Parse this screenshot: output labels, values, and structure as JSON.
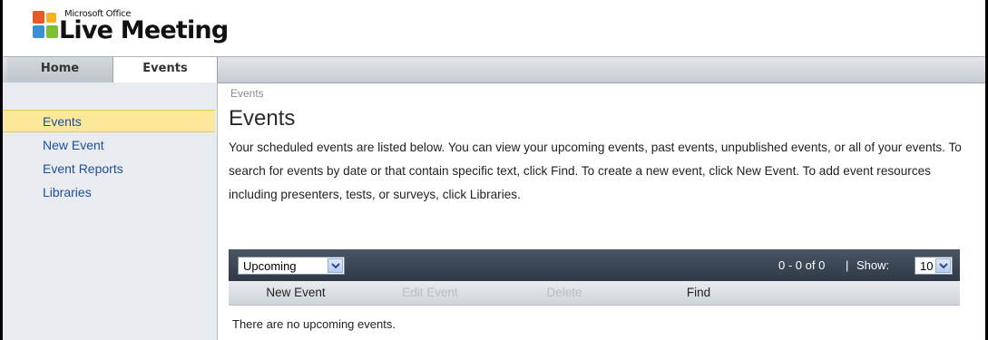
{
  "app": {
    "brand_small": "Microsoft Office",
    "brand_big": "Live Meeting"
  },
  "nav": {
    "tabs": [
      {
        "label": "Home",
        "active": false
      },
      {
        "label": "Events",
        "active": true
      }
    ]
  },
  "sidebar": {
    "items": [
      {
        "label": "Events",
        "active": true
      },
      {
        "label": "New Event",
        "active": false
      },
      {
        "label": "Event Reports",
        "active": false
      },
      {
        "label": "Libraries",
        "active": false
      }
    ]
  },
  "main": {
    "breadcrumb": "Events",
    "title": "Events",
    "description": "Your scheduled events are listed below. You can view your upcoming events, past events, unpublished events, or all of your events. To search for events by date or that contain specific text, click Find. To create a new event, click New Event. To add event resources including presenters, tests, or surveys, click Libraries."
  },
  "grid": {
    "filter_value": "Upcoming",
    "paging": "0 - 0 of 0",
    "separator": "|",
    "show_label": "Show:",
    "show_value": "10",
    "actions": {
      "new_event": "New Event",
      "edit_event": "Edit Event",
      "delete": "Delete",
      "find": "Find"
    },
    "empty_message": "There are no upcoming events."
  },
  "colors": {
    "link": "#1d4f9b",
    "active_sidebar": "#fbe89b",
    "grid_header": "#3a4452"
  }
}
